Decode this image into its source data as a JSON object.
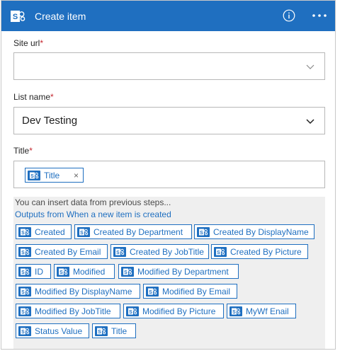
{
  "header": {
    "title": "Create item",
    "bg_color": "#1f6fc0"
  },
  "fields": {
    "site_url": {
      "label": "Site url",
      "required_mark": "*",
      "value": ""
    },
    "list_name": {
      "label": "List name",
      "required_mark": "*",
      "value": "Dev Testing"
    },
    "title": {
      "label": "Title",
      "required_mark": "*",
      "token_label": "Title",
      "remove_glyph": "×"
    }
  },
  "dynamic": {
    "hint": "You can insert data from previous steps...",
    "source": "Outputs from When a new item is created",
    "tokens": [
      "Created",
      "Created By Department",
      "Created By DisplayName",
      "Created By Email",
      "Created By JobTitle",
      "Created By Picture",
      "ID",
      "Modified",
      "Modified By Department",
      "Modified By DisplayName",
      "Modified By Email",
      "Modified By JobTitle",
      "Modified By Picture",
      "MyWf Enail",
      "Status Value",
      "Title"
    ]
  },
  "icons": {
    "logo": "sharepoint-icon",
    "info": "info-icon",
    "more": "more-icon",
    "chevron": "chevron-down-icon",
    "token": "sharepoint-token-icon"
  }
}
